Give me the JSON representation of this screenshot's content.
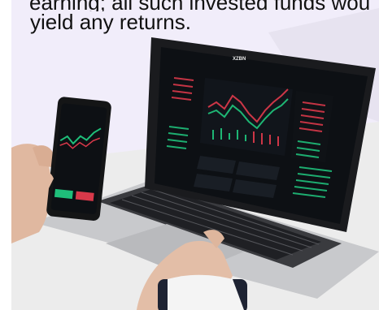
{
  "caption": {
    "line1": "earning; all such invested funds would",
    "line2": "yield any returns."
  },
  "laptop_screen": {
    "ticker": "XZBN"
  },
  "colors": {
    "background": "#f2eefb",
    "screen": "#0d1014",
    "buy": "#1fbf7a",
    "sell": "#d8394a",
    "desk": "#e9e9e9"
  }
}
